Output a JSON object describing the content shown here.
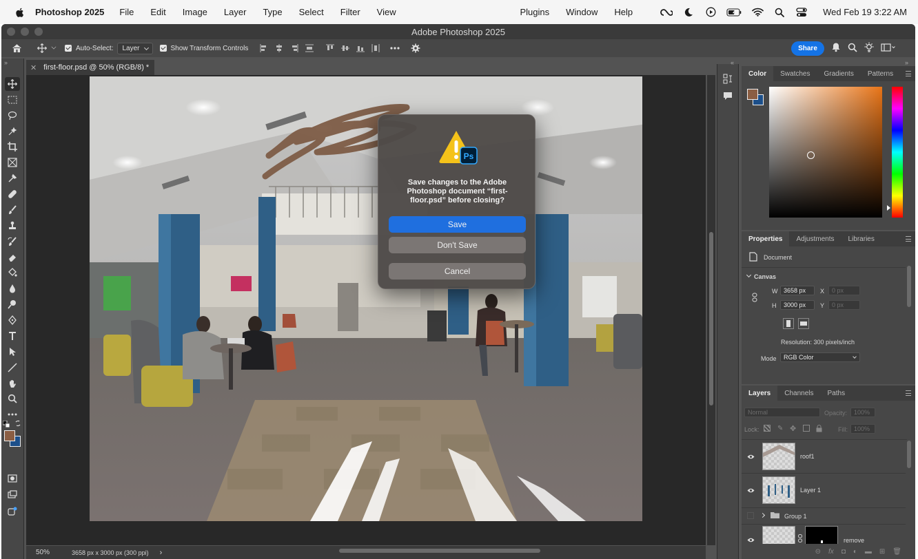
{
  "menubar": {
    "app_name": "Photoshop 2025",
    "items": [
      "File",
      "Edit",
      "Image",
      "Layer",
      "Type",
      "Select",
      "Filter",
      "View"
    ],
    "right_items": [
      "Plugins",
      "Window",
      "Help"
    ],
    "clock": "Wed Feb 19  3:22 AM"
  },
  "window": {
    "title": "Adobe Photoshop 2025"
  },
  "options": {
    "auto_select_label": "Auto-Select:",
    "auto_select_value": "Layer",
    "transform_label": "Show Transform Controls",
    "share_label": "Share"
  },
  "document": {
    "tab_label": "first-floor.psd @ 50% (RGB/8) *",
    "zoom": "50%",
    "doc_info": "3658 px x 3000 px (300 ppi)"
  },
  "dialog": {
    "message": "Save changes to the Adobe Photoshop document “first-floor.psd” before closing?",
    "badge": "Ps",
    "save_label": "Save",
    "dont_save_label": "Don't Save",
    "cancel_label": "Cancel"
  },
  "color_panel": {
    "tabs": [
      "Color",
      "Swatches",
      "Gradients",
      "Patterns"
    ],
    "foreground": "#8b5e43",
    "background": "#1c4f8a"
  },
  "properties_panel": {
    "tabs": [
      "Properties",
      "Adjustments",
      "Libraries"
    ],
    "doc_label": "Document",
    "section": "Canvas",
    "w_label": "W",
    "w_value": "3658 px",
    "h_label": "H",
    "h_value": "3000 px",
    "x_label": "X",
    "x_placeholder": "0 px",
    "y_label": "Y",
    "y_placeholder": "0 px",
    "resolution": "Resolution: 300 pixels/inch",
    "mode_label": "Mode",
    "mode_value": "RGB Color"
  },
  "layers_panel": {
    "tabs": [
      "Layers",
      "Channels",
      "Paths"
    ],
    "blend_mode": "Normal",
    "opacity_label": "Opacity:",
    "opacity_value": "100%",
    "lock_label": "Lock:",
    "fill_label": "Fill:",
    "fill_value": "100%",
    "layers": [
      {
        "name": "roof1"
      },
      {
        "name": "Layer 1"
      },
      {
        "name": "Group 1"
      },
      {
        "name": "remove"
      }
    ]
  }
}
